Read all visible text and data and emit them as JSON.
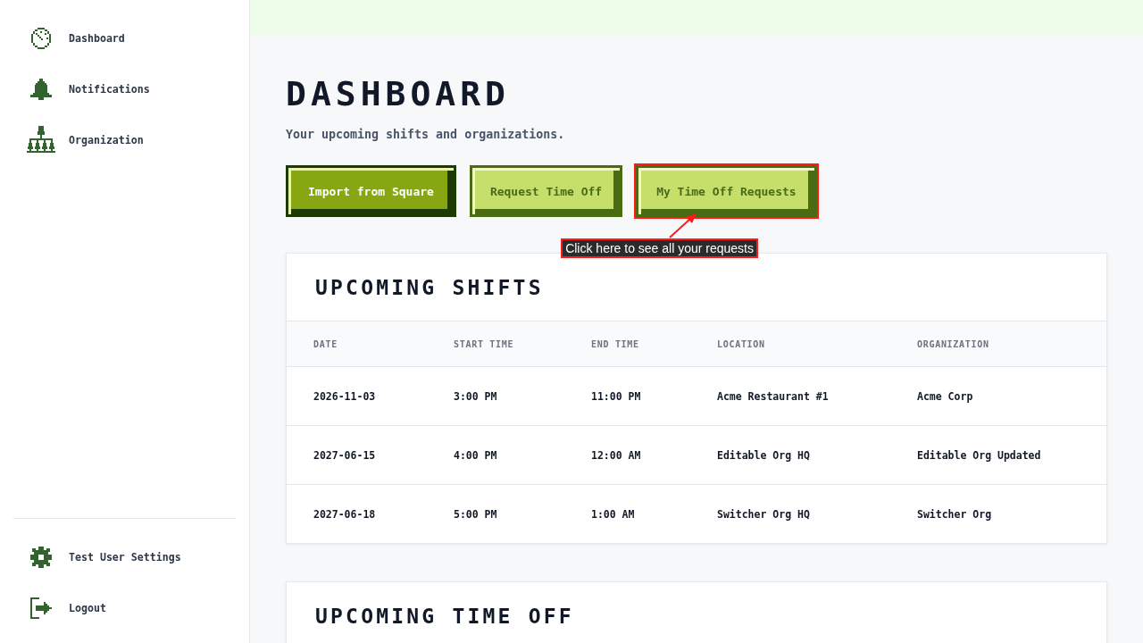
{
  "sidebar": {
    "nav": [
      {
        "label": "Dashboard"
      },
      {
        "label": "Notifications"
      },
      {
        "label": "Organization"
      }
    ],
    "footer": [
      {
        "label": "Test User Settings"
      },
      {
        "label": "Logout"
      }
    ]
  },
  "page": {
    "title": "DASHBOARD",
    "subtitle": "Your upcoming shifts and organizations."
  },
  "actions": [
    {
      "label": "Import from Square",
      "kind": "primary",
      "highlighted": false
    },
    {
      "label": "Request Time Off",
      "kind": "secondary",
      "highlighted": false
    },
    {
      "label": "My Time Off Requests",
      "kind": "secondary",
      "highlighted": true
    }
  ],
  "callout": {
    "text": "Click here to see all your requests"
  },
  "upcoming_shifts": {
    "title": "UPCOMING SHIFTS",
    "columns": [
      "DATE",
      "START TIME",
      "END TIME",
      "LOCATION",
      "ORGANIZATION"
    ],
    "rows": [
      [
        "2026-11-03",
        "3:00 PM",
        "11:00 PM",
        "Acme Restaurant #1",
        "Acme Corp"
      ],
      [
        "2027-06-15",
        "4:00 PM",
        "12:00 AM",
        "Editable Org HQ",
        "Editable Org Updated"
      ],
      [
        "2027-06-18",
        "5:00 PM",
        "1:00 AM",
        "Switcher Org HQ",
        "Switcher Org"
      ]
    ]
  },
  "upcoming_time_off": {
    "title": "UPCOMING TIME OFF"
  }
}
